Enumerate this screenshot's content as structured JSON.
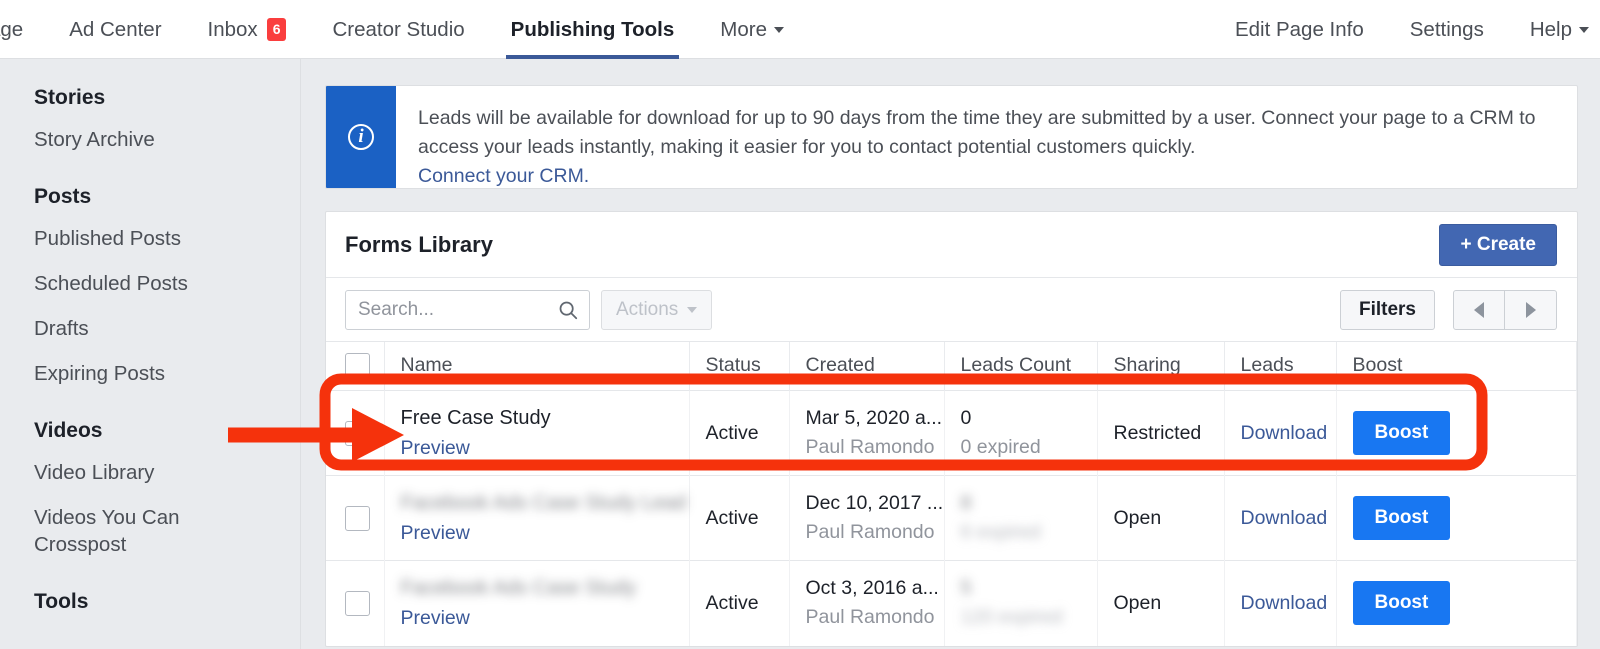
{
  "topnav": {
    "left_items": [
      {
        "label": "age",
        "badge": null,
        "caret": false,
        "active": false
      },
      {
        "label": "Ad Center",
        "badge": null,
        "caret": false,
        "active": false
      },
      {
        "label": "Inbox",
        "badge": "6",
        "caret": false,
        "active": false
      },
      {
        "label": "Creator Studio",
        "badge": null,
        "caret": false,
        "active": false
      },
      {
        "label": "Publishing Tools",
        "badge": null,
        "caret": false,
        "active": true
      },
      {
        "label": "More",
        "badge": null,
        "caret": true,
        "active": false
      }
    ],
    "right_items": [
      {
        "label": "Edit Page Info",
        "caret": false
      },
      {
        "label": "Settings",
        "caret": false
      },
      {
        "label": "Help",
        "caret": true
      }
    ],
    "active_underline_color": "#3b5998",
    "badge_color": "#fa3e3e"
  },
  "sidebar": {
    "groups": [
      {
        "title": "Stories",
        "items": [
          {
            "label": "Story Archive"
          }
        ]
      },
      {
        "title": "Posts",
        "items": [
          {
            "label": "Published Posts"
          },
          {
            "label": "Scheduled Posts"
          },
          {
            "label": "Drafts"
          },
          {
            "label": "Expiring Posts"
          }
        ]
      },
      {
        "title": "Videos",
        "items": [
          {
            "label": "Video Library"
          },
          {
            "label": "Videos You Can Crosspost"
          }
        ]
      },
      {
        "title": "Tools",
        "items": []
      }
    ]
  },
  "banner": {
    "icon": "info-icon",
    "icon_glyph": "i",
    "accent_color": "#1b61c4",
    "text": "Leads will be available for download for up to 90 days from the time they are submitted by a user. Connect your page to a CRM to access your leads instantly, making it easier for you to contact potential customers quickly.",
    "link_label": "Connect your CRM."
  },
  "card": {
    "title": "Forms Library",
    "create_button": "+ Create",
    "create_color": "#4267b2",
    "search": {
      "placeholder": "Search...",
      "value": "",
      "icon": "search-icon"
    },
    "actions_button": "Actions",
    "filters_button": "Filters",
    "pager": {
      "prev_icon": "chevron-left-icon",
      "next_icon": "chevron-right-icon"
    }
  },
  "table": {
    "columns": [
      {
        "key": "check",
        "label": ""
      },
      {
        "key": "name",
        "label": "Name"
      },
      {
        "key": "status",
        "label": "Status"
      },
      {
        "key": "created",
        "label": "Created"
      },
      {
        "key": "count",
        "label": "Leads Count"
      },
      {
        "key": "sharing",
        "label": "Sharing"
      },
      {
        "key": "leads",
        "label": "Leads"
      },
      {
        "key": "boost",
        "label": "Boost"
      }
    ],
    "rows": [
      {
        "name": "Free Case Study",
        "name_blurred": false,
        "preview_label": "Preview",
        "status": "Active",
        "created_date": "Mar 5, 2020 a...",
        "created_by": "Paul Ramondo",
        "leads_count": "0",
        "leads_count_blurred": false,
        "leads_expired": "0 expired",
        "sharing": "Restricted",
        "download_label": "Download",
        "boost_label": "Boost",
        "highlighted": true
      },
      {
        "name": "Facebook Ads Case Study Lead",
        "name_blurred": true,
        "preview_label": "Preview",
        "status": "Active",
        "created_date": "Dec 10, 2017 ...",
        "created_by": "Paul Ramondo",
        "leads_count": "8",
        "leads_count_blurred": true,
        "leads_expired": "6 expired",
        "sharing": "Open",
        "download_label": "Download",
        "boost_label": "Boost",
        "highlighted": false
      },
      {
        "name": "Facebook Ads Case Study",
        "name_blurred": true,
        "preview_label": "Preview",
        "status": "Active",
        "created_date": "Oct 3, 2016 a...",
        "created_by": "Paul Ramondo",
        "leads_count": "5",
        "leads_count_blurred": true,
        "leads_expired": "120 expired",
        "sharing": "Open",
        "download_label": "Download",
        "boost_label": "Boost",
        "highlighted": false
      }
    ],
    "boost_color": "#1877f2",
    "link_color": "#3b5998"
  },
  "annotation": {
    "highlight_color": "#f5320c",
    "shapes": [
      "rounded-rectangle-highlight",
      "left-pointing-arrow"
    ]
  }
}
